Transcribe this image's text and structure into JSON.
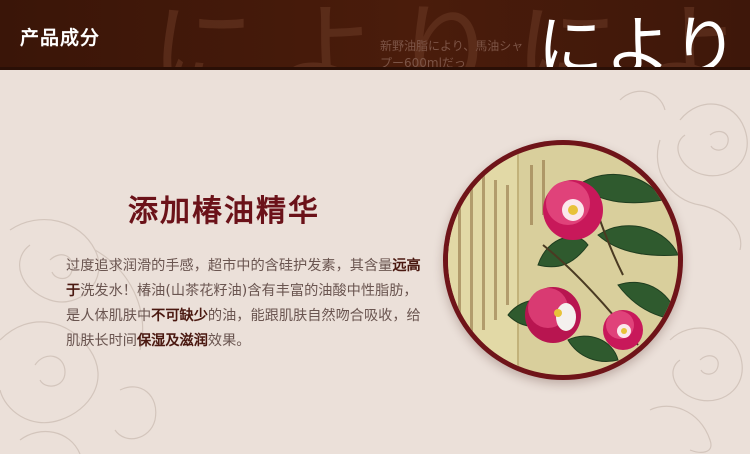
{
  "header": {
    "title": "产品成分",
    "ghost_text": "によりによ",
    "caption_line1": "新野油脂により、馬油シャ",
    "caption_line2": "プー600mlだっ",
    "brand": "により"
  },
  "section": {
    "heading": "添加椿油精华",
    "body": [
      {
        "text": "过度追求润滑的手感，超市中的含硅护发素，其含量",
        "bold": false
      },
      {
        "text": "远高于",
        "bold": true
      },
      {
        "text": "洗发水！椿油(山茶花籽油)含有丰富的油酸中性脂肪，是人体肌肤中",
        "bold": false
      },
      {
        "text": "不可缺少",
        "bold": true
      },
      {
        "text": "的油，能跟肌肤自然吻合吸收，给肌肤长时间",
        "bold": false
      },
      {
        "text": "保湿及滋润",
        "bold": true
      },
      {
        "text": "效果。",
        "bold": false
      }
    ]
  },
  "colors": {
    "header_bg": "#3a1508",
    "page_bg": "#ebe0d9",
    "heading": "#6b1219",
    "ring": "#6f1419",
    "camellia": "#c8185a"
  }
}
